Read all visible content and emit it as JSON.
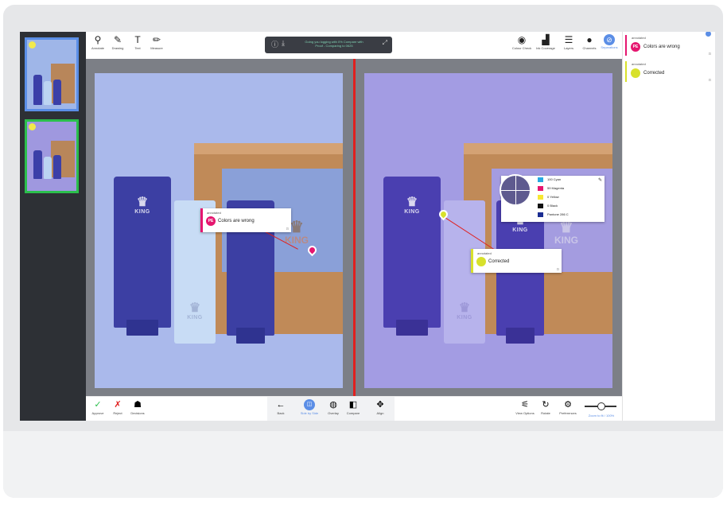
{
  "thumbnails": [
    {
      "label": "",
      "border_color": "#5b8ee6",
      "state": "selected"
    },
    {
      "label": "",
      "border_color": "#2bbf4c",
      "state": "approved"
    }
  ],
  "top_toolbar": {
    "tools": [
      {
        "label": "Annotate",
        "icon": "pin-icon"
      },
      {
        "label": "Drawing",
        "icon": "pen-icon"
      },
      {
        "label": "Text",
        "icon": "text-icon"
      },
      {
        "label": "Measure",
        "icon": "ruler-icon"
      }
    ],
    "file_info_line1": "Going you logging with 0% Compare with",
    "file_info_line2": "Proof - Comparing to 0625",
    "right_tools": [
      {
        "label": "Colour Check",
        "icon": "color-check-icon"
      },
      {
        "label": "Ink Coverage",
        "icon": "ink-icon"
      },
      {
        "label": "Layers",
        "icon": "layers-icon"
      },
      {
        "label": "Channels",
        "icon": "drop-icon"
      },
      {
        "label": "Separations",
        "icon": "separations-icon"
      }
    ]
  },
  "annotations": {
    "left": {
      "header": "annotated",
      "initials": "PE",
      "text": "Colors are wrong",
      "reply": "⊡",
      "color": "#e5166f"
    },
    "right": {
      "header": "annotated",
      "initials": "",
      "text": "Corrected",
      "reply": "⊡",
      "color": "#d8e12c"
    }
  },
  "separations": [
    {
      "label": "100 Cyan",
      "color": "#27a9e1"
    },
    {
      "label": "59 Magenta",
      "color": "#e5166f"
    },
    {
      "label": "0 Yellow",
      "color": "#f7e733"
    },
    {
      "label": "0 Black",
      "color": "#111111"
    },
    {
      "label": "Pantone 286 C",
      "color": "#1b2d92"
    }
  ],
  "product_text": {
    "brand": "KING",
    "crown_glyph": "♛"
  },
  "bottom_toolbar": {
    "left_tools": [
      {
        "label": "Approve",
        "icon": "check-icon",
        "color": "#2bbf4c"
      },
      {
        "label": "Reject",
        "icon": "x-icon",
        "color": "#e0201f"
      },
      {
        "label": "Decisions",
        "icon": "decisions-icon",
        "color": "#222222"
      }
    ],
    "center_tools": [
      {
        "label": "Back",
        "icon": "back-icon"
      },
      {
        "label": "Side by Side",
        "icon": "side-by-side-icon"
      },
      {
        "label": "Overlay",
        "icon": "overlay-icon"
      },
      {
        "label": "Compare",
        "icon": "compare-icon"
      },
      {
        "label": "Align",
        "icon": "align-icon"
      }
    ],
    "right_tools": [
      {
        "label": "View Options",
        "icon": "view-options-icon"
      },
      {
        "label": "Rotate",
        "icon": "rotate-icon"
      },
      {
        "label": "Preferences",
        "icon": "preferences-icon"
      }
    ],
    "zoom_label": "Zoom to fit / 100%",
    "zoom_level": 0.5
  },
  "comments_panel": [
    {
      "header": "annotated",
      "initials": "PE",
      "text": "Colors are wrong",
      "reply": "⊡",
      "color": "#e5166f"
    },
    {
      "header": "annotated",
      "initials": "",
      "text": "Corrected",
      "reply": "⊡",
      "color": "#d8e12c"
    }
  ]
}
